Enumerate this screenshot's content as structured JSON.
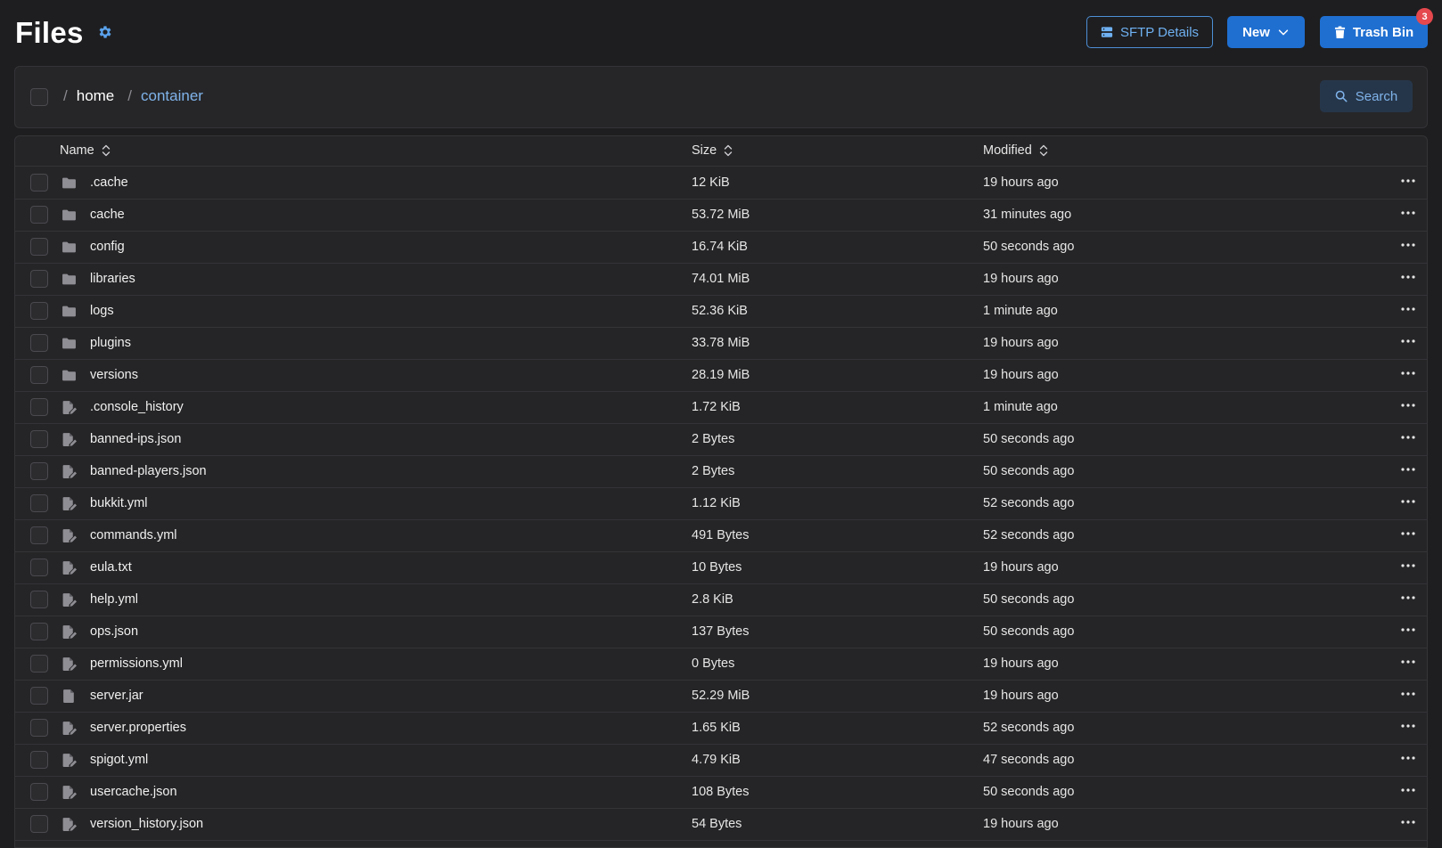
{
  "header": {
    "title": "Files",
    "settings_icon": "gear-icon",
    "sftp_label": "SFTP Details",
    "new_label": "New",
    "trash_label": "Trash Bin",
    "trash_count": "3"
  },
  "breadcrumb": {
    "separator": "/",
    "home": "home",
    "current": "container",
    "search_label": "Search"
  },
  "table": {
    "columns": {
      "name": "Name",
      "size": "Size",
      "modified": "Modified"
    },
    "rows": [
      {
        "type": "folder",
        "name": ".cache",
        "size": "12 KiB",
        "modified": "19 hours ago"
      },
      {
        "type": "folder",
        "name": "cache",
        "size": "53.72 MiB",
        "modified": "31 minutes ago"
      },
      {
        "type": "folder",
        "name": "config",
        "size": "16.74 KiB",
        "modified": "50 seconds ago"
      },
      {
        "type": "folder",
        "name": "libraries",
        "size": "74.01 MiB",
        "modified": "19 hours ago"
      },
      {
        "type": "folder",
        "name": "logs",
        "size": "52.36 KiB",
        "modified": "1 minute ago"
      },
      {
        "type": "folder",
        "name": "plugins",
        "size": "33.78 MiB",
        "modified": "19 hours ago"
      },
      {
        "type": "folder",
        "name": "versions",
        "size": "28.19 MiB",
        "modified": "19 hours ago"
      },
      {
        "type": "text",
        "name": ".console_history",
        "size": "1.72 KiB",
        "modified": "1 minute ago"
      },
      {
        "type": "text",
        "name": "banned-ips.json",
        "size": "2 Bytes",
        "modified": "50 seconds ago"
      },
      {
        "type": "text",
        "name": "banned-players.json",
        "size": "2 Bytes",
        "modified": "50 seconds ago"
      },
      {
        "type": "text",
        "name": "bukkit.yml",
        "size": "1.12 KiB",
        "modified": "52 seconds ago"
      },
      {
        "type": "text",
        "name": "commands.yml",
        "size": "491 Bytes",
        "modified": "52 seconds ago"
      },
      {
        "type": "text",
        "name": "eula.txt",
        "size": "10 Bytes",
        "modified": "19 hours ago"
      },
      {
        "type": "text",
        "name": "help.yml",
        "size": "2.8 KiB",
        "modified": "50 seconds ago"
      },
      {
        "type": "text",
        "name": "ops.json",
        "size": "137 Bytes",
        "modified": "50 seconds ago"
      },
      {
        "type": "text",
        "name": "permissions.yml",
        "size": "0 Bytes",
        "modified": "19 hours ago"
      },
      {
        "type": "binary",
        "name": "server.jar",
        "size": "52.29 MiB",
        "modified": "19 hours ago"
      },
      {
        "type": "text",
        "name": "server.properties",
        "size": "1.65 KiB",
        "modified": "52 seconds ago"
      },
      {
        "type": "text",
        "name": "spigot.yml",
        "size": "4.79 KiB",
        "modified": "47 seconds ago"
      },
      {
        "type": "text",
        "name": "usercache.json",
        "size": "108 Bytes",
        "modified": "50 seconds ago"
      },
      {
        "type": "text",
        "name": "version_history.json",
        "size": "54 Bytes",
        "modified": "19 hours ago"
      }
    ]
  },
  "colors": {
    "background": "#1e1e20",
    "card": "#252527",
    "accent": "#1f6fd1",
    "link": "#7fb3ea",
    "badge": "#e5484d"
  }
}
